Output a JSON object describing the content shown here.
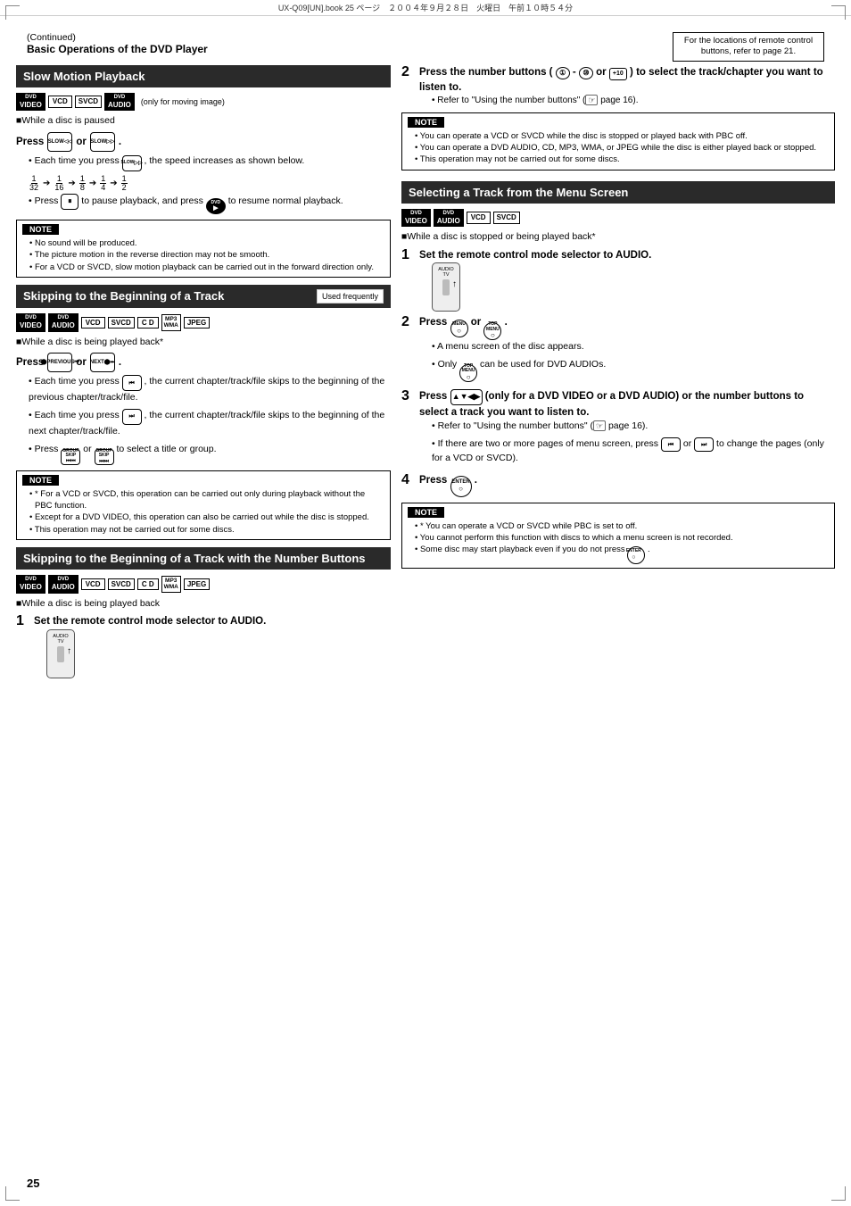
{
  "page": {
    "number": "25",
    "file_info": "UX-Q09[UN].book  25 ページ　２００４年９月２８日　火曜日　午前１０時５４分"
  },
  "header": {
    "continued": "(Continued)",
    "title": "Basic Operations of the DVD Player",
    "note_box": "For the locations of remote control buttons, refer to page 21."
  },
  "slow_motion": {
    "title": "Slow Motion Playback",
    "badges": [
      "DVD VIDEO",
      "VCD",
      "SVCD",
      "DVD AUDIO"
    ],
    "only_text": "(only for moving image)",
    "condition": "■While a disc is paused",
    "press_label": "Press",
    "or_label": "or",
    "press_note": "Each time you press      , the speed increases as shown below.",
    "fractions": [
      "1/32",
      "1/16",
      "1/8",
      "1/4",
      "1/2"
    ],
    "pause_note": "Press      to pause playback, and press      to resume normal playback.",
    "note_title": "NOTE",
    "notes": [
      "No sound will be produced.",
      "The picture motion in the reverse direction may not be smooth.",
      "For a VCD or SVCD, slow motion playback can be carried out in the forward direction only."
    ]
  },
  "skipping_track": {
    "title": "Skipping to the Beginning of a Track",
    "used_frequently": "Used frequently",
    "badges": [
      "DVD VIDEO",
      "DVD AUDIO",
      "VCD",
      "SVCD",
      "C D",
      "MP3 WMA",
      "JPEG"
    ],
    "condition": "■While a disc is being played back*",
    "press_label": "Press",
    "or_label": "or",
    "bullets": [
      "Each time you press      , the current chapter/track/file skips to the beginning of the previous chapter/track/file.",
      "Each time you press      , the current chapter/track/file skips to the beginning of the next chapter/track/file.",
      "Press      or      to select a title or group."
    ],
    "note_title": "NOTE",
    "notes": [
      "* For a VCD or SVCD, this operation can be carried out only during playback without the PBC function.",
      "Except for a DVD VIDEO, this operation can also be carried out while the disc is stopped.",
      "This operation may not be carried out for some discs."
    ]
  },
  "skipping_number_buttons": {
    "title": "Skipping to the Beginning of a Track with the Number Buttons",
    "badges": [
      "DVD VIDEO",
      "DVD AUDIO",
      "VCD",
      "SVCD",
      "C D",
      "MP3 WMA",
      "JPEG"
    ],
    "condition": "■While a disc is being played back",
    "step1": {
      "num": "1",
      "title": "Set the remote control mode selector to AUDIO."
    },
    "step2": {
      "num": "2",
      "title": "Press the number buttons (     -     or      ) to select the track/chapter you want to listen to.",
      "sub": "• Refer to \"Using the number buttons\" (     page 16)."
    }
  },
  "selecting_track_menu": {
    "title": "Selecting a Track from the Menu Screen",
    "badges": [
      "DVD VIDEO",
      "DVD AUDIO",
      "VCD",
      "SVCD"
    ],
    "condition": "■While a disc is stopped or being played back*",
    "step1": {
      "num": "1",
      "title": "Set the remote control mode selector to AUDIO."
    },
    "step2": {
      "num": "2",
      "title": "Press      or      .",
      "bullets": [
        "A menu screen of the disc appears.",
        "Only      can be used for DVD AUDIOs."
      ]
    },
    "step3": {
      "num": "3",
      "title": "Press      (only for a DVD VIDEO or a DVD AUDIO) or the number buttons to select a track you want to listen to.",
      "bullets": [
        "Refer to \"Using the number buttons\" (     page 16).",
        "If there are two or more pages of menu screen, press      or      to change the pages (only for a VCD or SVCD)."
      ]
    },
    "step4": {
      "num": "4",
      "title": "Press      ."
    },
    "note_title": "NOTE",
    "notes": [
      "* You can operate a VCD or SVCD while PBC is set to off.",
      "You cannot perform this function with discs to which a menu screen is not recorded.",
      "Some disc may start playback even if you do not press      ."
    ]
  }
}
